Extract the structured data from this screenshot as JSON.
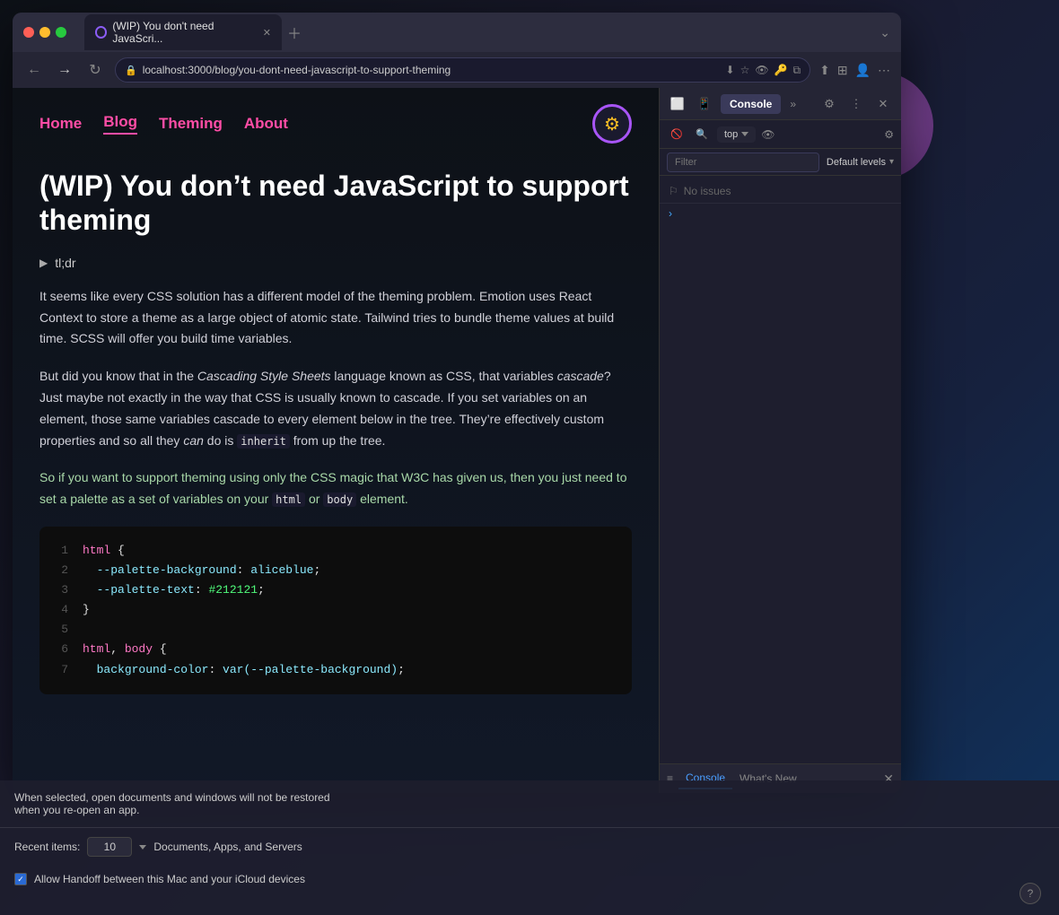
{
  "desktop": {
    "bg_note": "dark gradient desktop background"
  },
  "browser": {
    "tab_label": "(WIP) You don't need JavaScri...",
    "url": "localhost:3000/blog/you-dont-need-javascript-to-support-theming",
    "window_title": "(WIP) You don't need JavaScript to support theming"
  },
  "nav": {
    "home": "Home",
    "blog": "Blog",
    "theming": "Theming",
    "about": "About",
    "gear_icon_label": "gear-icon"
  },
  "article": {
    "title": "(WIP) You don’t need JavaScript to support theming",
    "tldr": "tl;dr",
    "p1": "It seems like every CSS solution has a different model of the theming problem. Emotion uses React Context to store a theme as a large object of atomic state. Tailwind tries to bundle theme values at build time. SCSS will offer you build time variables.",
    "p2_before": "But did you know that in the ",
    "p2_italic": "Cascading Style Sheets",
    "p2_mid": " language known as CSS, that variables ",
    "p2_italic2": "cascade",
    "p2_after": "? Just maybe not exactly in the way that CSS is usually known to cascade. If you set variables on an element, those same variables cascade to every element below in the tree. They’re effectively custom properties and so all they ",
    "p2_italic3": "can",
    "p2_after2": " do is ",
    "p2_code": "inherit",
    "p2_end": " from up the tree.",
    "p3_before": "So if you want to support theming using only the CSS magic that W3C has given us, then you just need to set a palette as a set of variables on your ",
    "p3_code1": "html",
    "p3_or": " or",
    "p3_code2": "body",
    "p3_end": " element."
  },
  "code": {
    "lines": [
      {
        "num": "1",
        "text": "html {"
      },
      {
        "num": "2",
        "text": "  --palette-background: aliceblue;"
      },
      {
        "num": "3",
        "text": "  --palette-text: #212121;"
      },
      {
        "num": "4",
        "text": "}"
      },
      {
        "num": "5",
        "text": ""
      },
      {
        "num": "6",
        "text": "html, body {"
      },
      {
        "num": "7",
        "text": "  background-color: var(--palette-background);"
      }
    ]
  },
  "devtools": {
    "console_tab": "Console",
    "chevron": "»",
    "filter_placeholder": "Filter",
    "default_levels": "Default levels",
    "no_issues": "No issues",
    "top_label": "top",
    "console_arrow": "›",
    "whats_new": "What's New"
  },
  "drawer": {
    "console_tab": "Console",
    "whats_new_tab": "What's New",
    "message1": "When selected, open documents and windows will not be restored",
    "message2": "when you re-open an app.",
    "recent_items_label": "Recent items:",
    "recent_items_value": "10",
    "docs_label": "Documents, Apps, and Servers",
    "handoff_label": "Allow Handoff between this Mac and your iCloud devices"
  },
  "help": {
    "icon": "?"
  }
}
